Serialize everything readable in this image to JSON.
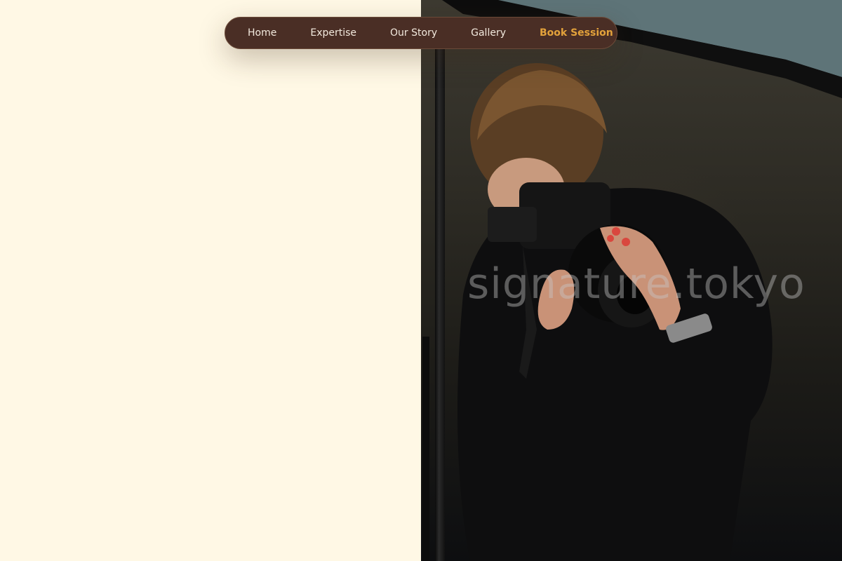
{
  "nav": {
    "items": [
      {
        "label": "Home"
      },
      {
        "label": "Expertise"
      },
      {
        "label": "Our Story"
      },
      {
        "label": "Gallery"
      }
    ],
    "cta_label": "Book Session"
  },
  "hero": {
    "watermark": "signature.tokyo",
    "photo_subject": "photographer-with-camera"
  },
  "colors": {
    "page_background": "#fff8e5",
    "nav_background": "#4a2e25",
    "nav_text": "#f2e9dd",
    "cta_accent": "#e3a23b"
  }
}
